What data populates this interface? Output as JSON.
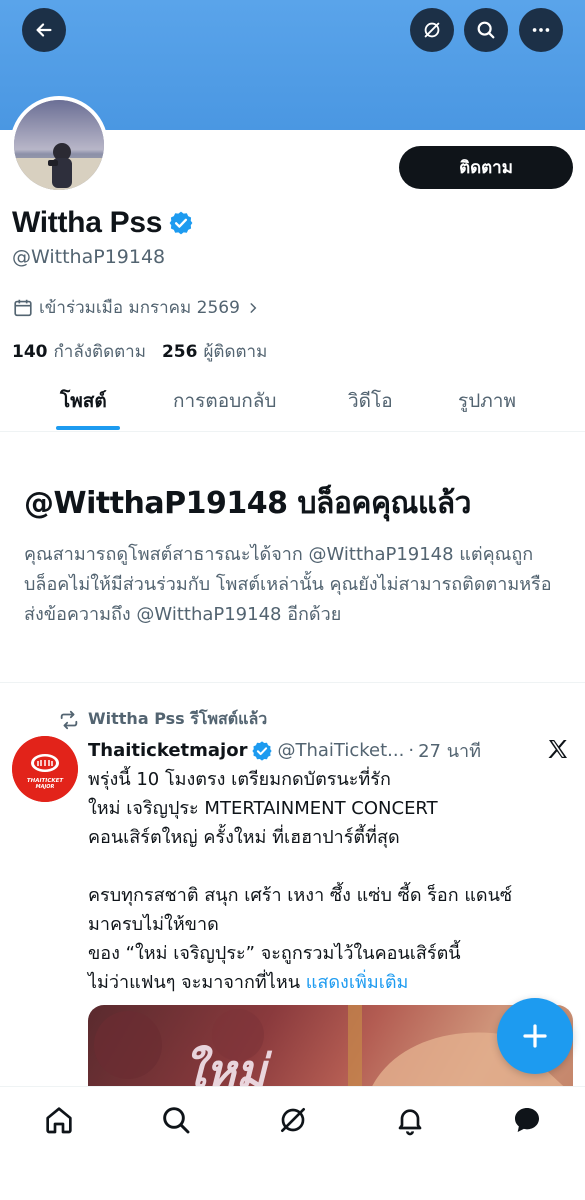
{
  "header": {
    "back_icon": "arrow-left-icon",
    "grok_icon": "grok-icon",
    "search_icon": "search-icon",
    "more_icon": "more-horizontal-icon",
    "banner_color": "#4a97e2"
  },
  "profile": {
    "follow_label": "ติดตาม",
    "name": "Wittha Pss",
    "handle": "@WitthaP19148",
    "joined": "เข้าร่วมเมือ มกราคม 2569",
    "following_count": "140",
    "following_label": "กำลังติดตาม",
    "followers_count": "256",
    "followers_label": "ผู้ติดตาม"
  },
  "tabs": [
    {
      "label": "โพสต์",
      "active": true
    },
    {
      "label": "การตอบกลับ",
      "active": false
    },
    {
      "label": "วิดีโอ",
      "active": false
    },
    {
      "label": "รูปภาพ",
      "active": false
    }
  ],
  "blocked": {
    "title": "@WitthaP19148 บล็อคคุณแล้ว",
    "description": "คุณสามารถดูโพสต์สาธารณะได้จาก @WitthaP19148 แต่คุณถูกบล็อคไม่ให้มีส่วนร่วมกับ โพสต์เหล่านั้น คุณยังไม่สามารถติดตามหรือส่งข้อความถึง @WitthaP19148 อีกด้วย"
  },
  "post": {
    "repost_label": "Wittha Pss รีโพสต์แล้ว",
    "author_name": "Thaiticketmajor",
    "author_handle": "@ThaiTicket...",
    "time": "27 นาที",
    "lines": [
      "พรุ่งนี้ 10 โมงตรง เตรียมกดบัตรนะที่รัก",
      "ใหม่ เจริญปุระ MTERTAINMENT CONCERT",
      "คอนเสิร์ตใหญ่ ครั้งใหม่ ที่เฮฮาปาร์ตี้ที่สุด",
      "",
      "ครบทุกรสชาติ สนุก เศร้า เหงา ซึ้ง แซ่บ ซี้ด ร็อก แดนซ์",
      "มาครบไม่ให้ขาด",
      "ของ “ใหม่ เจริญปุระ” จะถูกรวมไว้ในคอนเสิร์ตนี้",
      "ไม่ว่าแฟนๆ จะมาจากที่ไหน"
    ],
    "show_more": "แสดงเพิ่มเติม",
    "logo_text": "THAITICKET MAJOR",
    "media_text": "ใหม่"
  },
  "fab_icon": "plus-icon",
  "nav": {
    "home": "home-icon",
    "search": "search-icon",
    "grok": "grok-icon",
    "notifications": "bell-icon",
    "messages": "chat-bubble-icon"
  },
  "accent_color": "#1d9bf0"
}
